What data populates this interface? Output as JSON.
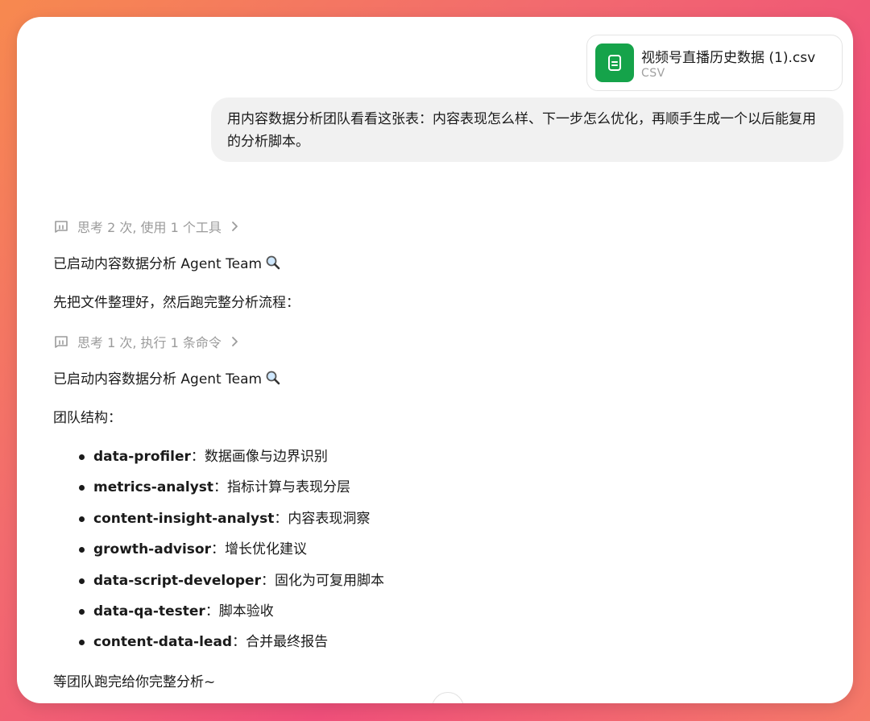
{
  "attachment": {
    "icon": "document-icon",
    "name": "视频号直播历史数据 (1).csv",
    "type": "CSV",
    "icon_color": "#15a34a"
  },
  "user_message": "用内容数据分析团队看看这张表：内容表现怎么样、下一步怎么优化，再顺手生成一个以后能复用的分析脚本。",
  "assistant": {
    "thought_1": "思考 2 次, 使用 1 个工具",
    "line_1": "已启动内容数据分析 Agent Team",
    "line_2": "先把文件整理好，然后跑完整分析流程：",
    "thought_2": "思考 1 次, 执行 1 条命令",
    "line_3": "已启动内容数据分析 Agent Team",
    "line_4": "团队结构：",
    "team": [
      {
        "role": "data-profiler",
        "desc": "：数据画像与边界识别"
      },
      {
        "role": "metrics-analyst",
        "desc": "：指标计算与表现分层"
      },
      {
        "role": "content-insight-analyst",
        "desc": "：内容表现洞察"
      },
      {
        "role": "growth-advisor",
        "desc": "：增长优化建议"
      },
      {
        "role": "data-script-developer",
        "desc": "：固化为可复用脚本"
      },
      {
        "role": "data-qa-tester",
        "desc": "：脚本验收"
      },
      {
        "role": "content-data-lead",
        "desc": "：合并最终报告"
      }
    ],
    "line_5": "等团队跑完给你完整分析~"
  },
  "colors": {
    "bubble": "#f1f1f1",
    "muted_text": "#9b9b9b"
  }
}
